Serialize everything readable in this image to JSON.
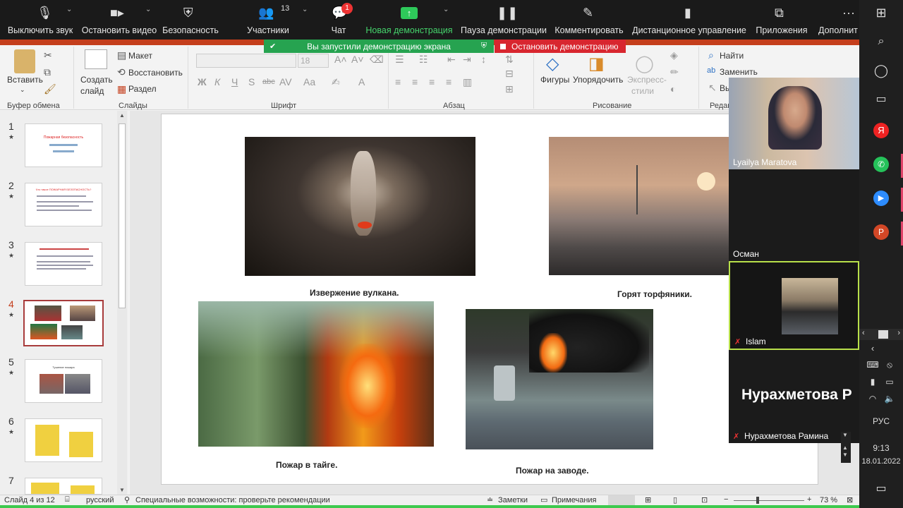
{
  "zoom_toolbar": {
    "items": [
      {
        "label": "Выключить звук",
        "icon": "microphone-icon"
      },
      {
        "label": "Остановить видео",
        "icon": "video-camera-icon"
      },
      {
        "label": "Безопасность",
        "icon": "shield-icon"
      },
      {
        "label": "Участники",
        "icon": "participants-icon",
        "count": "13"
      },
      {
        "label": "Чат",
        "icon": "chat-icon",
        "badge": "1"
      },
      {
        "label": "Новая демонстрация",
        "icon": "share-screen-icon"
      },
      {
        "label": "Пауза демонстрации",
        "icon": "pause-icon"
      },
      {
        "label": "Комментировать",
        "icon": "pen-icon"
      },
      {
        "label": "Дистанционное управление",
        "icon": "mouse-icon"
      },
      {
        "label": "Приложения",
        "icon": "apps-icon"
      },
      {
        "label": "Дополнит",
        "icon": "more-icon"
      }
    ],
    "share_notice": "Вы запустили демонстрацию экрана",
    "stop_share": "Остановить демонстрацию"
  },
  "ribbon": {
    "paste": "Вставить",
    "clipboard_group": "Буфер обмена",
    "create_slide": "Создать",
    "create_slide2": "слайд",
    "layout": "Макет",
    "restore": "Восстановить",
    "section": "Раздел",
    "slides_group": "Слайды",
    "font_size": "18",
    "font_group": "Шрифт",
    "paragraph_group": "Абзац",
    "shapes": "Фигуры",
    "arrange": "Упорядочить",
    "express_styles": "Экспресс-",
    "express_styles2": "стили",
    "drawing_group": "Рисование",
    "find": "Найти",
    "replace": "Заменить",
    "select": "Вы",
    "editing_group": "Редак"
  },
  "slides_panel": {
    "thumbnails": [
      {
        "number": "1",
        "title": "Пожарная безопасность"
      },
      {
        "number": "2",
        "title": "Что такое ПОЖАРНАЯ БЕЗОПАСНОСТЬ?"
      },
      {
        "number": "3",
        "title": ""
      },
      {
        "number": "4",
        "title": ""
      },
      {
        "number": "5",
        "title": "Тушение пожара"
      },
      {
        "number": "6",
        "title": ""
      },
      {
        "number": "7",
        "title": ""
      }
    ],
    "selected_index": 4
  },
  "slide": {
    "captions": [
      "Извержение вулкана.",
      "Горят торфяники.",
      "Пожар в тайге.",
      "Пожар на заводе."
    ]
  },
  "status_bar": {
    "slide_counter": "Слайд 4 из 12",
    "language": "русский",
    "accessibility": "Специальные возможности: проверьте рекомендации",
    "notes": "Заметки",
    "comments": "Примечания",
    "zoom": "73 %"
  },
  "gallery": {
    "participants": [
      {
        "name": "Lyailya Maratova"
      },
      {
        "name": "Осман"
      },
      {
        "name": "Islam"
      },
      {
        "name": "Нурахметова Рамина",
        "big_name": "Нурахметова Р"
      }
    ]
  },
  "taskbar": {
    "language": "РУС",
    "time": "9:13",
    "date": "18.01.2022"
  }
}
